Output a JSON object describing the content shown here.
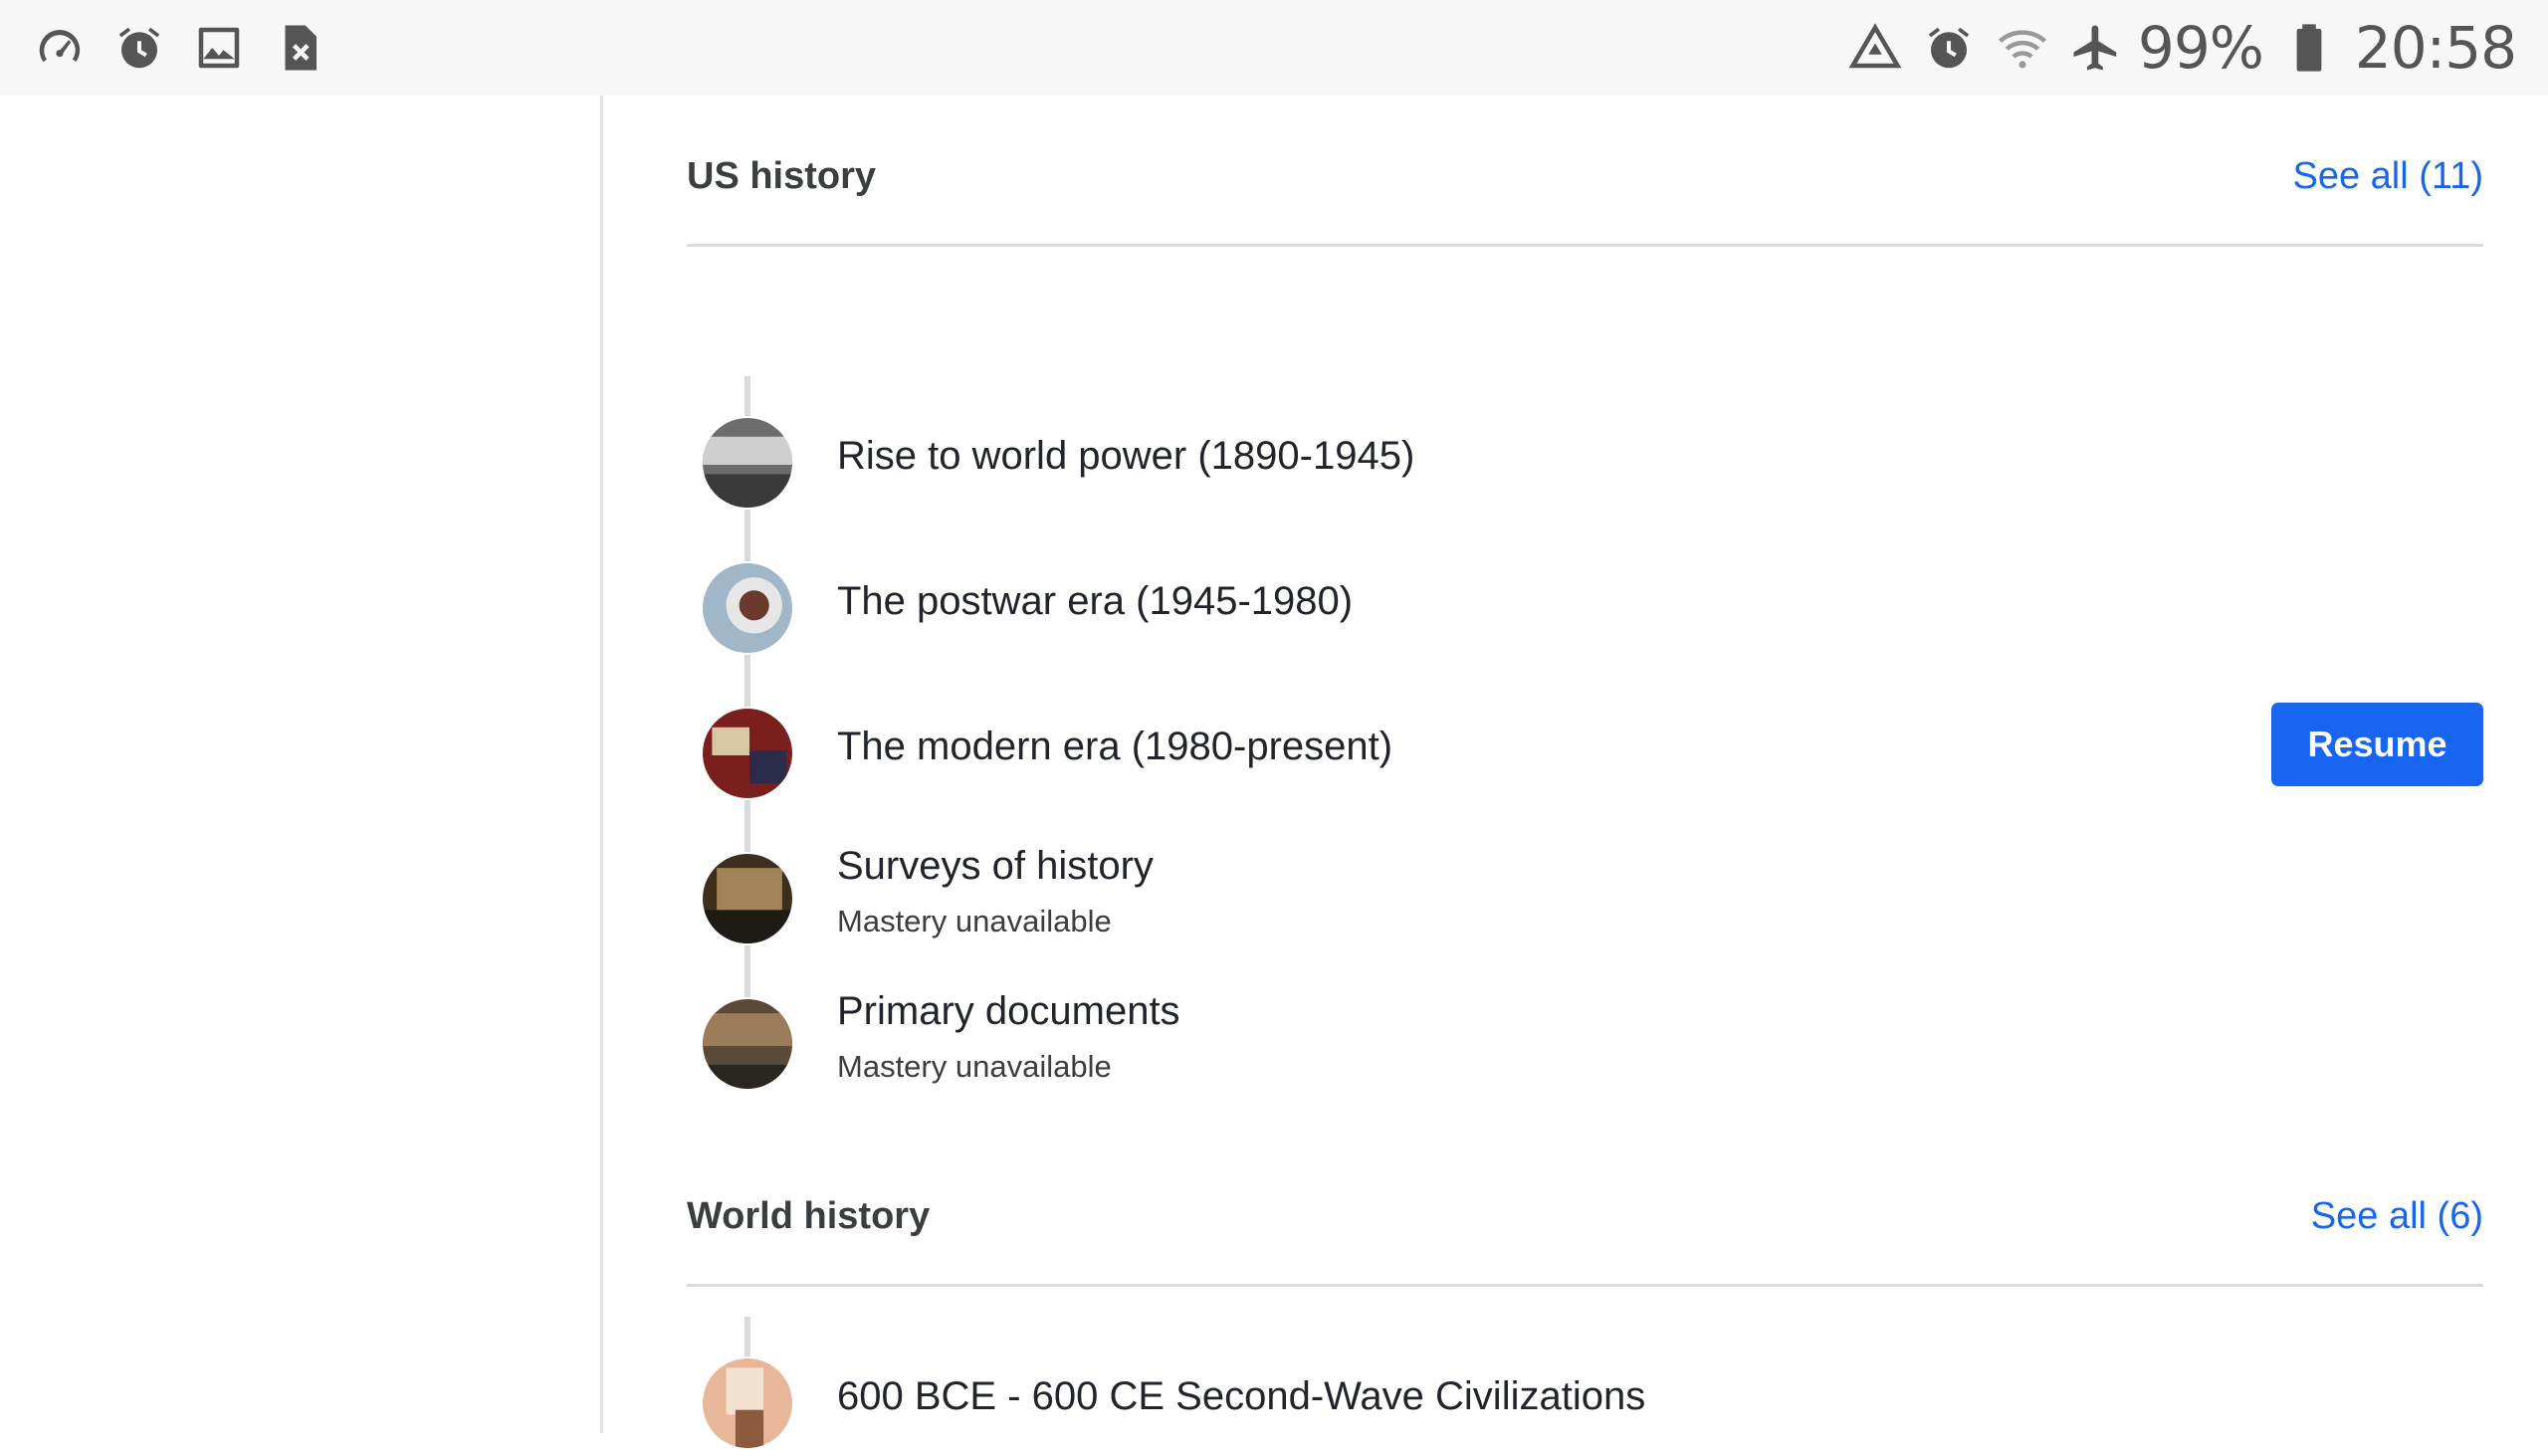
{
  "status_bar": {
    "left_icons": [
      "speedometer-icon",
      "alarm-icon",
      "image-icon",
      "sim-error-icon"
    ],
    "right_icons": [
      "recycle-warning-icon",
      "alarm-icon",
      "wifi-icon",
      "airplane-icon",
      "battery-icon"
    ],
    "battery": "99%",
    "time": "20:58"
  },
  "sections": [
    {
      "title": "US history",
      "see_all": "See all (11)",
      "units": [
        {
          "title": "Rise to world power (1890-1945)",
          "subtitle": "",
          "thumb_colors": [
            "#6d6d6d",
            "#cfcfcf",
            "#3a3a3a"
          ]
        },
        {
          "title": "The postwar era (1945-1980)",
          "subtitle": "",
          "thumb_colors": [
            "#9fb7c9",
            "#e6e6e6",
            "#6b3a2c"
          ]
        },
        {
          "title": "The modern era (1980-present)",
          "subtitle": "",
          "thumb_colors": [
            "#7a1e1e",
            "#d8c7a4",
            "#2b2b4a"
          ]
        },
        {
          "title": "Surveys of history",
          "subtitle": "Mastery unavailable",
          "thumb_colors": [
            "#3d2f1e",
            "#a08356",
            "#1e1a14"
          ]
        },
        {
          "title": "Primary documents",
          "subtitle": "Mastery unavailable",
          "thumb_colors": [
            "#5a4a3a",
            "#9b7c5a",
            "#2a2620"
          ]
        }
      ],
      "resume_label": "Resume"
    },
    {
      "title": "World history",
      "see_all": "See all (6)",
      "units": [
        {
          "title": "600 BCE - 600 CE Second-Wave Civilizations",
          "subtitle": "",
          "thumb_colors": [
            "#e8b79a",
            "#f3e1cf",
            "#8c5a3c"
          ]
        }
      ]
    }
  ],
  "colors": {
    "accent": "#1865f2",
    "divider": "#dcdcdc",
    "timeline": "#dadada"
  }
}
